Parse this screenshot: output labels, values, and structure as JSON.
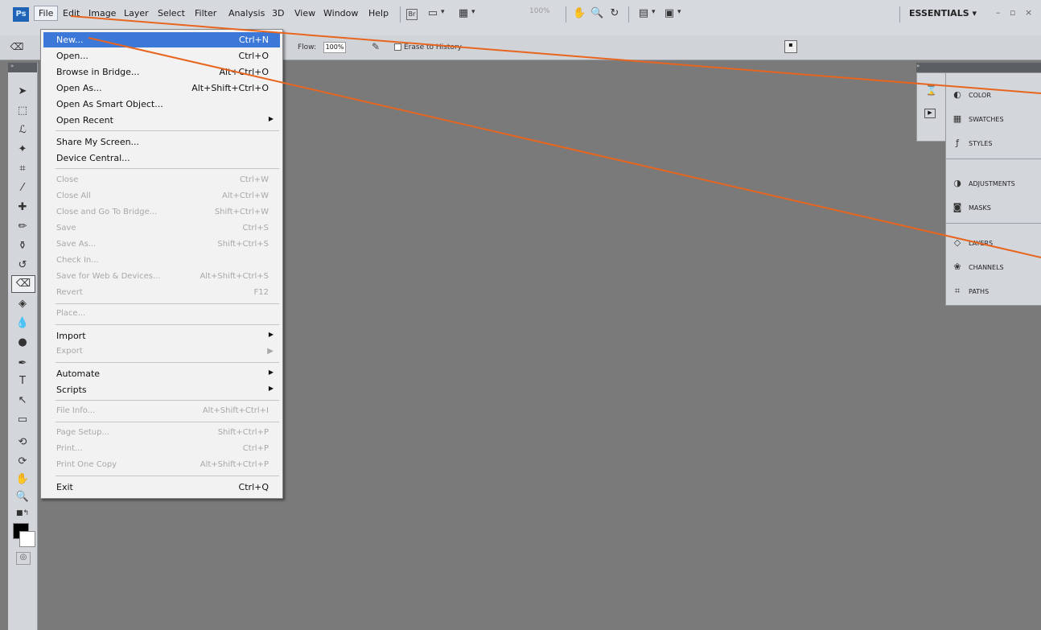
{
  "menubar": {
    "logo": "Ps",
    "menus": [
      "File",
      "Edit",
      "Image",
      "Layer",
      "Select",
      "Filter",
      "Analysis",
      "3D",
      "View",
      "Window",
      "Help"
    ],
    "zoom": "100%",
    "workspace": "ESSENTIALS ▾",
    "window_controls": "– ▫ ×"
  },
  "options_bar": {
    "flow_label": "Flow:",
    "flow_value": "100%",
    "erase_to_history": "Erase to History"
  },
  "file_menu": {
    "items": [
      {
        "label": "New...",
        "shortcut": "Ctrl+N",
        "highlighted": true
      },
      {
        "label": "Open...",
        "shortcut": "Ctrl+O"
      },
      {
        "label": "Browse in Bridge...",
        "shortcut": "Alt+Ctrl+O"
      },
      {
        "label": "Open As...",
        "shortcut": "Alt+Shift+Ctrl+O"
      },
      {
        "label": "Open As Smart Object...",
        "shortcut": ""
      },
      {
        "label": "Open Recent",
        "shortcut": ""
      },
      {
        "label": "Share My Screen...",
        "shortcut": ""
      },
      {
        "label": "Device Central...",
        "shortcut": ""
      },
      {
        "label": "Close",
        "shortcut": "Ctrl+W",
        "disabled": true
      },
      {
        "label": "Close All",
        "shortcut": "Alt+Ctrl+W",
        "disabled": true
      },
      {
        "label": "Close and Go To Bridge...",
        "shortcut": "Shift+Ctrl+W",
        "disabled": true
      },
      {
        "label": "Save",
        "shortcut": "Ctrl+S",
        "disabled": true
      },
      {
        "label": "Save As...",
        "shortcut": "Shift+Ctrl+S",
        "disabled": true
      },
      {
        "label": "Check In...",
        "shortcut": "",
        "disabled": true
      },
      {
        "label": "Save for Web & Devices...",
        "shortcut": "Alt+Shift+Ctrl+S",
        "disabled": true
      },
      {
        "label": "Revert",
        "shortcut": "F12",
        "disabled": true
      },
      {
        "label": "Place...",
        "shortcut": "",
        "disabled": true
      },
      {
        "label": "Import",
        "shortcut": ""
      },
      {
        "label": "Export",
        "shortcut": "",
        "disabled": true
      },
      {
        "label": "Automate",
        "shortcut": ""
      },
      {
        "label": "Scripts",
        "shortcut": ""
      },
      {
        "label": "File Info...",
        "shortcut": "Alt+Shift+Ctrl+I",
        "disabled": true
      },
      {
        "label": "Page Setup...",
        "shortcut": "Shift+Ctrl+P",
        "disabled": true
      },
      {
        "label": "Print...",
        "shortcut": "Ctrl+P",
        "disabled": true
      },
      {
        "label": "Print One Copy",
        "shortcut": "Alt+Shift+Ctrl+P",
        "disabled": true
      },
      {
        "label": "Exit",
        "shortcut": "Ctrl+Q"
      }
    ]
  },
  "panels": {
    "items": [
      {
        "label": "COLOR",
        "icon": "color-icon"
      },
      {
        "label": "SWATCHES",
        "icon": "swatches-icon"
      },
      {
        "label": "STYLES",
        "icon": "styles-icon"
      },
      {
        "label": "ADJUSTMENTS",
        "icon": "adjustments-icon"
      },
      {
        "label": "MASKS",
        "icon": "masks-icon"
      },
      {
        "label": "LAYERS",
        "icon": "layers-icon"
      },
      {
        "label": "CHANNELS",
        "icon": "channels-icon"
      },
      {
        "label": "PATHS",
        "icon": "paths-icon"
      }
    ]
  },
  "colors": {
    "accent": "#3c78d8",
    "annotation": "#e8651f",
    "canvas": "#7a7a7a",
    "foreground": "#000000",
    "background": "#ffffff"
  }
}
